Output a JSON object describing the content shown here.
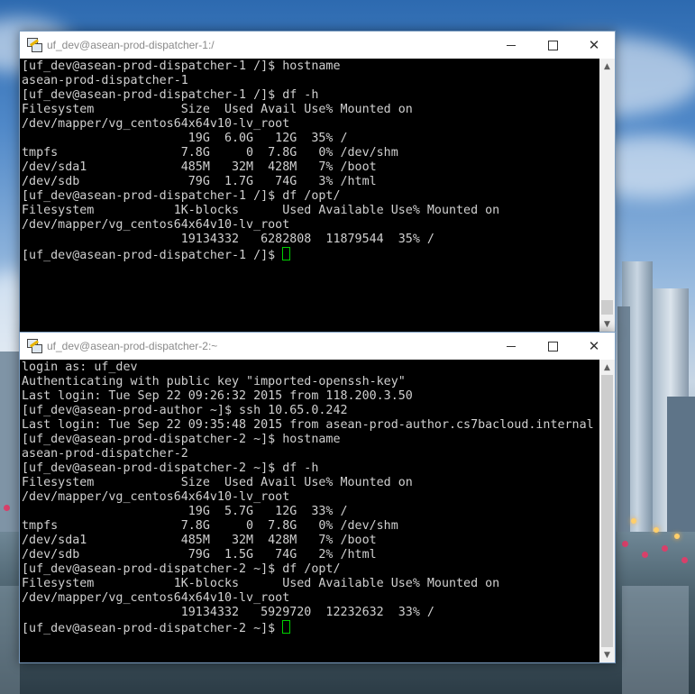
{
  "window1": {
    "title": "uf_dev@asean-prod-dispatcher-1:/",
    "lines": [
      "[uf_dev@asean-prod-dispatcher-1 /]$ hostname",
      "asean-prod-dispatcher-1",
      "[uf_dev@asean-prod-dispatcher-1 /]$ df -h",
      "Filesystem            Size  Used Avail Use% Mounted on",
      "/dev/mapper/vg_centos64x64v10-lv_root",
      "                       19G  6.0G   12G  35% /",
      "tmpfs                 7.8G     0  7.8G   0% /dev/shm",
      "/dev/sda1             485M   32M  428M   7% /boot",
      "/dev/sdb               79G  1.7G   74G   3% /html",
      "[uf_dev@asean-prod-dispatcher-1 /]$ df /opt/",
      "Filesystem           1K-blocks      Used Available Use% Mounted on",
      "/dev/mapper/vg_centos64x64v10-lv_root",
      "                      19134332   6282808  11879544  35% /"
    ],
    "prompt": "[uf_dev@asean-prod-dispatcher-1 /]$ "
  },
  "window2": {
    "title": "uf_dev@asean-prod-dispatcher-2:~",
    "lines": [
      "login as: uf_dev",
      "Authenticating with public key \"imported-openssh-key\"",
      "Last login: Tue Sep 22 09:26:32 2015 from 118.200.3.50",
      "[uf_dev@asean-prod-author ~]$ ssh 10.65.0.242",
      "Last login: Tue Sep 22 09:35:48 2015 from asean-prod-author.cs7bacloud.internal",
      "[uf_dev@asean-prod-dispatcher-2 ~]$ hostname",
      "asean-prod-dispatcher-2",
      "[uf_dev@asean-prod-dispatcher-2 ~]$ df -h",
      "Filesystem            Size  Used Avail Use% Mounted on",
      "/dev/mapper/vg_centos64x64v10-lv_root",
      "                       19G  5.7G   12G  33% /",
      "tmpfs                 7.8G     0  7.8G   0% /dev/shm",
      "/dev/sda1             485M   32M  428M   7% /boot",
      "/dev/sdb               79G  1.5G   74G   2% /html",
      "[uf_dev@asean-prod-dispatcher-2 ~]$ df /opt/",
      "Filesystem           1K-blocks      Used Available Use% Mounted on",
      "/dev/mapper/vg_centos64x64v10-lv_root",
      "                      19134332   5929720  12232632  33% /"
    ],
    "prompt": "[uf_dev@asean-prod-dispatcher-2 ~]$ "
  },
  "colors": {
    "terminal_bg": "#000000",
    "terminal_fg": "#d0d0d0",
    "cursor": "#00d000",
    "titlebar_text": "#8a8a8a"
  },
  "icons": {
    "app": "putty-icon",
    "minimize": "minimize-icon",
    "maximize": "maximize-icon",
    "close": "close-icon",
    "scroll_up": "scroll-up-arrow-icon",
    "scroll_down": "scroll-down-arrow-icon"
  }
}
